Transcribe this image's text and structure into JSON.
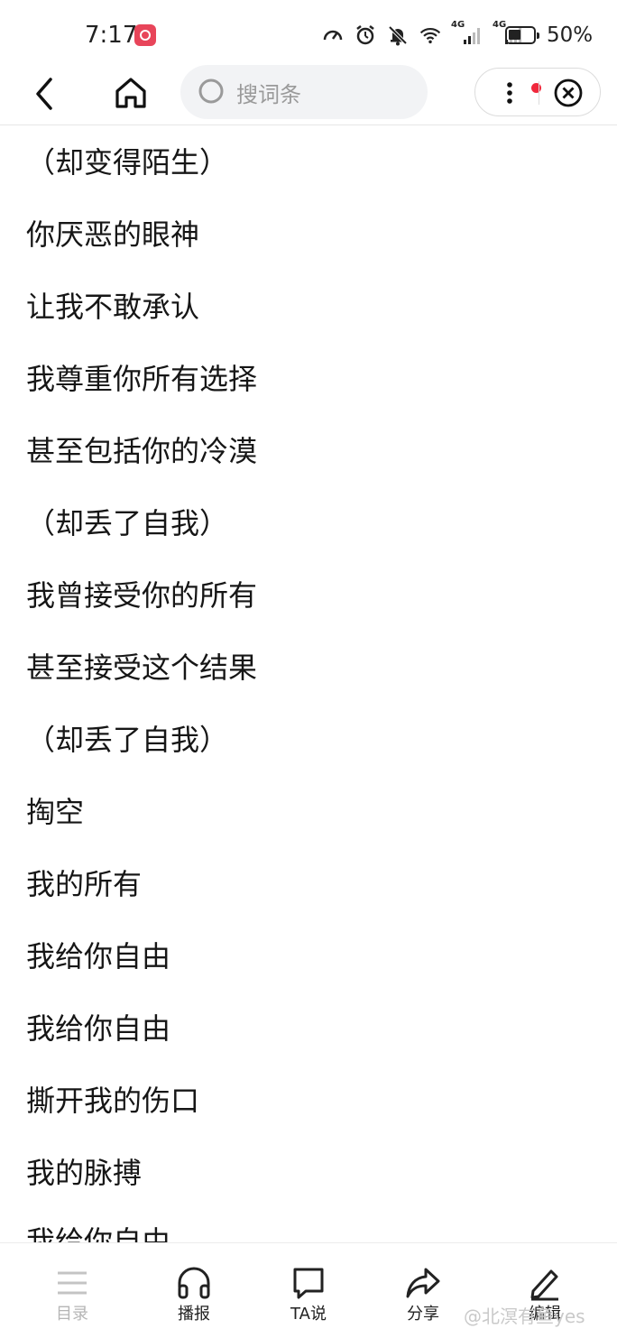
{
  "status_bar": {
    "time": "7:17",
    "battery": "50%",
    "signal_label_1": "4G",
    "signal_label_2": "4G"
  },
  "nav": {
    "search_placeholder": "搜词条"
  },
  "lyrics": [
    "（却变得陌生）",
    "你厌恶的眼神",
    "让我不敢承认",
    "我尊重你所有选择",
    "甚至包括你的冷漠",
    "（却丢了自我）",
    "我曾接受你的所有",
    "甚至接受这个结果",
    "（却丢了自我）",
    "掏空",
    "我的所有",
    "我给你自由",
    "我给你自由",
    "撕开我的伤口",
    "我的脉搏",
    "我给你自由"
  ],
  "toolbar": {
    "items": [
      {
        "label": "目录",
        "icon": "list-icon"
      },
      {
        "label": "播报",
        "icon": "headphones-icon"
      },
      {
        "label": "TA说",
        "icon": "comment-icon"
      },
      {
        "label": "分享",
        "icon": "share-icon"
      },
      {
        "label": "编辑",
        "icon": "edit-icon"
      }
    ]
  },
  "watermark": "@北溟有鱼yes",
  "colors": {
    "notification_dot": "#f0283c",
    "search_bg": "#f2f3f5",
    "disabled_label": "#b5b5b5"
  }
}
